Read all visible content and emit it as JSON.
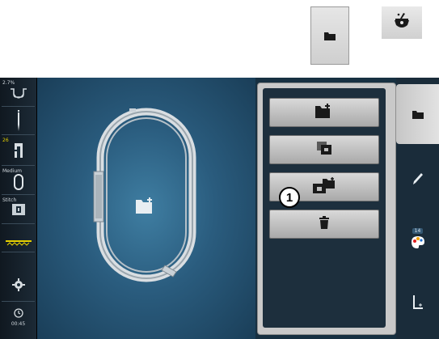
{
  "reference_buttons": {
    "file_icon": "folder-icon",
    "mortar_icon": "embroidery-mortar-icon"
  },
  "status_bar": {
    "hoop_dimension": "2.7%",
    "needle_icon": "needle-icon",
    "presser_foot_number": "26",
    "hoop_label": "Medium",
    "stitch_plate_label": "Stitch",
    "stabilizer_icon": "stabilizer-icon",
    "settings_icon": "gear-icon",
    "time_readout": "00:45"
  },
  "panel": {
    "buttons": [
      {
        "id": "save-new",
        "icon": "folder-save-icon"
      },
      {
        "id": "copy",
        "icon": "copy-icon"
      },
      {
        "id": "overwrite",
        "icon": "folder-overwrite-icon"
      },
      {
        "id": "delete",
        "icon": "trash-icon"
      }
    ],
    "marker_number": "1"
  },
  "tabs": {
    "file": "folder-icon",
    "edit": "pencil-icon",
    "color_badge": "14",
    "color": "color-palette-icon",
    "stitch": "stitch-icon"
  },
  "colors": {
    "screen_bg": "#173041",
    "accent_yellow": "#e6d000",
    "button_gray": "#c4c4c4"
  }
}
